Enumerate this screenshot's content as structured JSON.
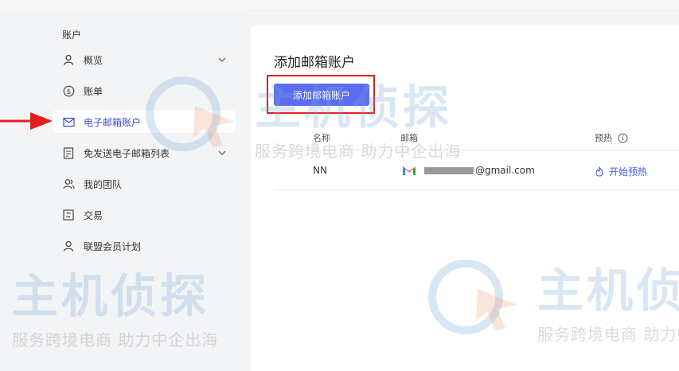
{
  "sidebar": {
    "section_title": "账户",
    "items": [
      {
        "label": "概览",
        "icon": "user-icon"
      },
      {
        "label": "账单",
        "icon": "dollar-circle-icon"
      },
      {
        "label": "电子邮箱账户",
        "icon": "mail-icon"
      },
      {
        "label": "免发送电子邮箱列表",
        "icon": "document-list-icon"
      },
      {
        "label": "我的团队",
        "icon": "team-icon"
      },
      {
        "label": "交易",
        "icon": "transaction-icon"
      },
      {
        "label": "联盟会员计划",
        "icon": "affiliate-icon"
      }
    ]
  },
  "main": {
    "title": "添加邮箱账户",
    "add_button_label": "添加邮箱账户",
    "table": {
      "headers": [
        "名称",
        "邮箱",
        "预热"
      ],
      "rows": [
        {
          "name": "NN",
          "email_suffix": "@gmail.com",
          "action": "开始预热"
        }
      ]
    }
  },
  "watermark": {
    "logo_text": "主机侦探",
    "tagline": "服务跨境电商 助力中企出海"
  },
  "colors": {
    "accent": "#5b6cf0",
    "highlight_border": "#e02020",
    "arrow": "#e02020",
    "active_text": "#3d4bd6"
  }
}
